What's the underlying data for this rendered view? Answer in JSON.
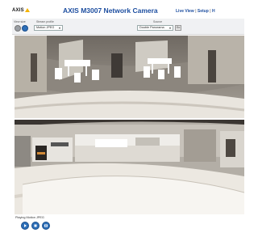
{
  "header": {
    "logo_text": "AXIS",
    "title": "AXIS M3007 Network Camera",
    "nav_live": "Live View",
    "nav_setup": "Setup",
    "nav_help": "H",
    "nav_sep": " | "
  },
  "toolbar": {
    "view_size_label": "View size",
    "stream_profile_label": "Stream profile",
    "stream_profile_value": "Motion JPEG",
    "source_label": "Source",
    "source_value": "Double Panorama",
    "go_label": "Go"
  },
  "status": {
    "text": "Playing Motion JPEG"
  },
  "colors": {
    "brand": "#1e4fa0",
    "button": "#2d6fb8",
    "logo_accent": "#f5b400"
  },
  "icons": {
    "view_size_full": "fullsize-icon",
    "view_size_scaled": "scaled-icon",
    "play": "play-icon",
    "stop": "stop-icon",
    "snapshot": "snapshot-icon"
  }
}
